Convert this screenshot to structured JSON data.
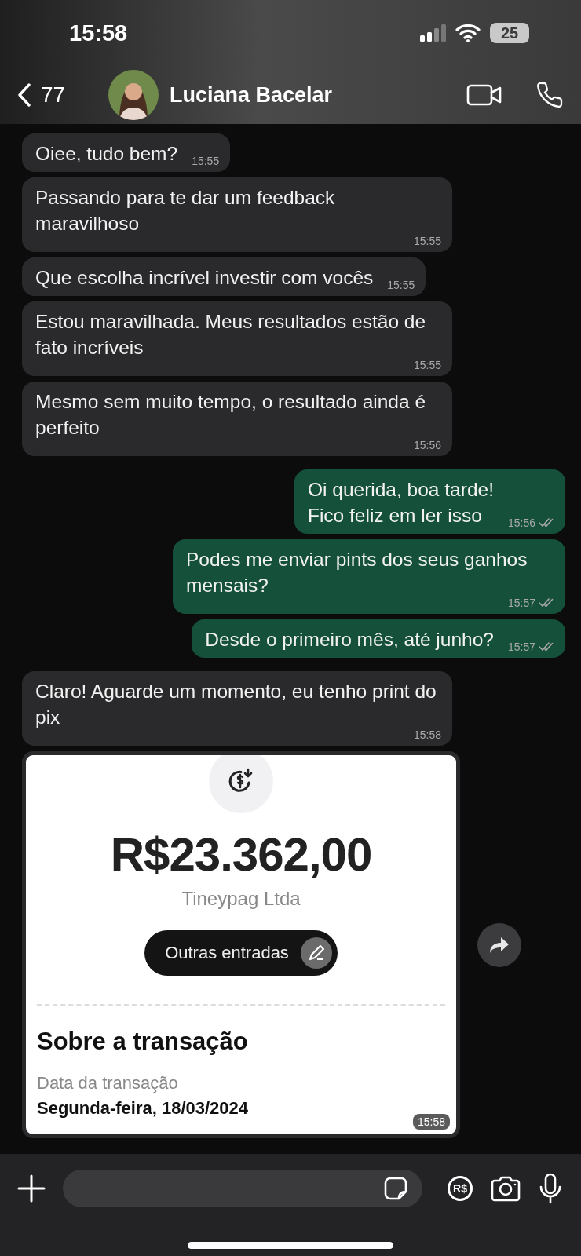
{
  "status_bar": {
    "time": "15:58",
    "battery": "25"
  },
  "header": {
    "back_count": "77",
    "contact_name": "Luciana Bacelar"
  },
  "messages": [
    {
      "kind": "text",
      "outgoing": false,
      "text": "Oiee, tudo bem?",
      "time": "15:55",
      "ticks": false
    },
    {
      "kind": "text",
      "outgoing": false,
      "text": "Passando para te dar um feedback maravilhoso",
      "time": "15:55",
      "ticks": false
    },
    {
      "kind": "text",
      "outgoing": false,
      "text": "Que escolha incrível investir com vocês",
      "time": "15:55",
      "ticks": false
    },
    {
      "kind": "text",
      "outgoing": false,
      "text": "Estou maravilhada. Meus resultados estão de fato incríveis",
      "time": "15:55",
      "ticks": false
    },
    {
      "kind": "text",
      "outgoing": false,
      "text": "Mesmo sem muito tempo, o resultado ainda é perfeito",
      "time": "15:56",
      "ticks": false
    },
    {
      "kind": "text",
      "outgoing": true,
      "text": "Oi querida, boa tarde!\nFico feliz em ler isso",
      "time": "15:56",
      "ticks": true
    },
    {
      "kind": "text",
      "outgoing": true,
      "text": "Podes me enviar pints dos seus ganhos mensais?",
      "time": "15:57",
      "ticks": true
    },
    {
      "kind": "text",
      "outgoing": true,
      "text": "Desde o primeiro mês, até junho?",
      "time": "15:57",
      "ticks": true
    },
    {
      "kind": "text",
      "outgoing": false,
      "text": "Claro! Aguarde um momento, eu tenho print do pix",
      "time": "15:58",
      "ticks": false
    },
    {
      "kind": "receipt",
      "outgoing": false,
      "time": "15:58",
      "receipt": {
        "amount": "R$23.362,00",
        "payer": "Tineypag Ltda",
        "category": "Outras entradas",
        "section_title": "Sobre a transação",
        "date_label": "Data da transação",
        "date_value": "Segunda-feira, 18/03/2024"
      }
    }
  ],
  "composer": {
    "payment_label": "R$"
  }
}
